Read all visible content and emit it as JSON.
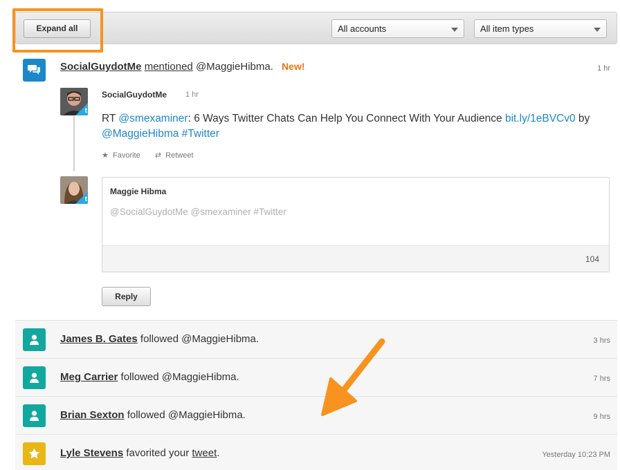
{
  "toolbar": {
    "expand_label": "Expand all",
    "accounts_select": "All accounts",
    "types_select": "All item types"
  },
  "mention": {
    "icon": "chat-bubble-icon",
    "user": "SocialGuydotMe",
    "action": "mentioned",
    "target": "@MaggieHibma.",
    "new_badge": "New!",
    "time": "1 hr"
  },
  "tweet": {
    "author": "SocialGuydotMe",
    "time": "1 hr",
    "text_rt": "RT ",
    "text_m1": "@smexaminer",
    "text_mid": ": 6 Ways Twitter Chats Can Help You Connect With Your Audience ",
    "text_link": "bit.ly/1eBVCv0",
    "text_by": " by ",
    "text_m2": "@MaggieHibma",
    "text_tag": " #Twitter",
    "favorite_label": "Favorite",
    "retweet_label": "Retweet"
  },
  "reply_box": {
    "author": "Maggie Hibma",
    "draft": "@SocialGuydotMe @smexaminer #Twitter",
    "char_count": "104",
    "reply_label": "Reply"
  },
  "activity": [
    {
      "icon": "person-icon",
      "user": "James B. Gates",
      "text": " followed @MaggieHibma.",
      "time": "3 hrs"
    },
    {
      "icon": "person-icon",
      "user": "Meg Carrier",
      "text": " followed @MaggieHibma.",
      "time": "7 hrs"
    },
    {
      "icon": "person-icon",
      "user": "Brian Sexton",
      "text": " followed @MaggieHibma.",
      "time": "9 hrs"
    },
    {
      "icon": "star-icon",
      "user": "Lyle Stevens",
      "text": " favorited your ",
      "link": "tweet",
      "tail": ".",
      "time": "Yesterday 10:23 PM"
    }
  ],
  "colors": {
    "highlight": "#f7931e",
    "mention_icon": "#1c87c9",
    "follow_icon": "#13a89e",
    "favorite_icon": "#e8b714",
    "new_badge": "#e87511",
    "link": "#1c87c9"
  }
}
